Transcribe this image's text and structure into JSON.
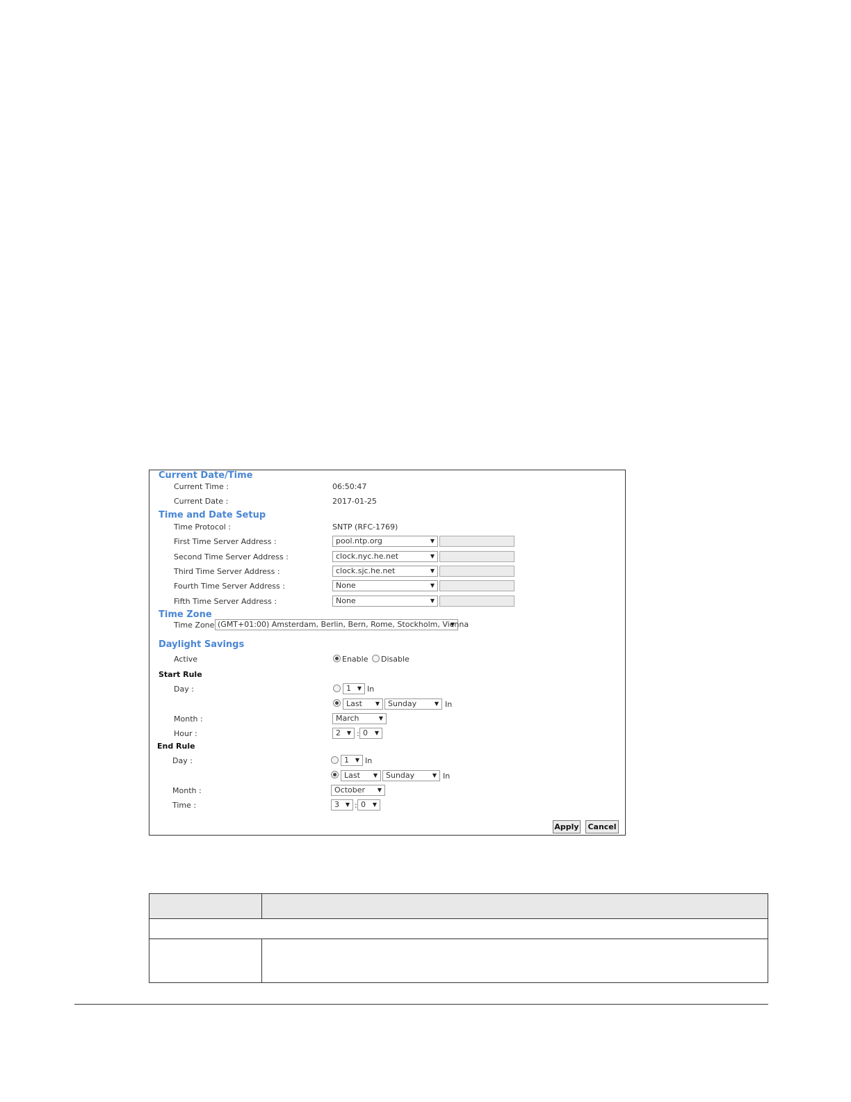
{
  "sections": {
    "current": "Current Date/Time",
    "setup": "Time and Date Setup",
    "timezone": "Time Zone",
    "daylight": "Daylight Savings",
    "start_rule": "Start Rule",
    "end_rule": "End Rule"
  },
  "current": {
    "time_label": "Current Time :",
    "time_value": "06:50:47",
    "date_label": "Current Date :",
    "date_value": "2017-01-25"
  },
  "setup": {
    "protocol_label": "Time Protocol :",
    "protocol_value": "SNTP (RFC-1769)",
    "servers": [
      {
        "label": "First Time Server Address :",
        "value": "pool.ntp.org"
      },
      {
        "label": "Second Time Server Address :",
        "value": "clock.nyc.he.net"
      },
      {
        "label": "Third Time Server Address :",
        "value": "clock.sjc.he.net"
      },
      {
        "label": "Fourth Time Server Address :",
        "value": "None"
      },
      {
        "label": "Fifth Time Server Address :",
        "value": "None"
      }
    ]
  },
  "timezone": {
    "label": "Time Zone :",
    "value": "(GMT+01:00) Amsterdam, Berlin, Bern, Rome, Stockholm, Vienna"
  },
  "daylight": {
    "active_label": "Active",
    "enable": "Enable",
    "disable": "Disable",
    "active_selected": "enable"
  },
  "start_rule": {
    "day_label": "Day :",
    "day_num": "1",
    "in1": "In",
    "week": "Last",
    "weekday": "Sunday",
    "in2": "In",
    "month_label": "Month :",
    "month": "March",
    "hour_label": "Hour :",
    "hour": "2",
    "colon": ":",
    "minute": "0"
  },
  "end_rule": {
    "day_label": "Day :",
    "day_num": "1",
    "in1": "In",
    "week": "Last",
    "weekday": "Sunday",
    "in2": "In",
    "month_label": "Month :",
    "month": "October",
    "time_label": "Time :",
    "hour": "3",
    "colon": ":",
    "minute": "0"
  },
  "buttons": {
    "apply": "Apply",
    "cancel": "Cancel"
  },
  "colors": {
    "section_heading": "#4a86d4",
    "input_disabled": "#ececec",
    "table_header": "#e8e8e8"
  }
}
